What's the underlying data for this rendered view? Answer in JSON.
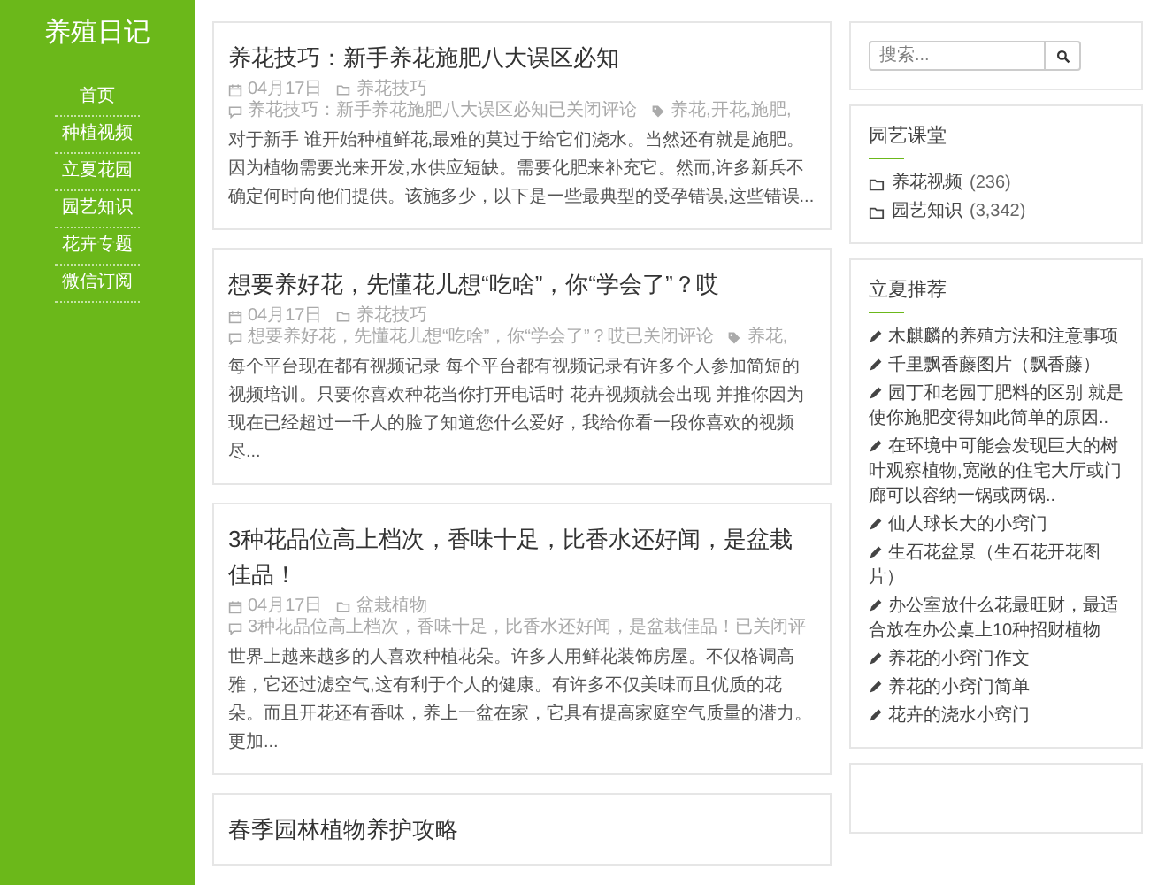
{
  "site_title": "养殖日记",
  "nav": [
    {
      "label": "首页"
    },
    {
      "label": "种植视频"
    },
    {
      "label": "立夏花园"
    },
    {
      "label": "园艺知识"
    },
    {
      "label": "花卉专题"
    },
    {
      "label": "微信订阅"
    }
  ],
  "posts": [
    {
      "title": "养花技巧：新手养花施肥八大误区必知",
      "date": "04月17日",
      "category": "养花技巧",
      "comments": "养花技巧：新手养花施肥八大误区必知已关闭评论",
      "tags": "养花,开花,施肥,",
      "excerpt": "对于新手 谁开始种植鲜花,最难的莫过于给它们浇水。当然还有就是施肥。因为植物需要光来开发,水供应短缺。需要化肥来补充它。然而,许多新兵不确定何时向他们提供。该施多少，以下是一些最典型的受孕错误,这些错误..."
    },
    {
      "title": "想要养好花，先懂花儿想“吃啥”，你“学会了”？哎",
      "date": "04月17日",
      "category": "养花技巧",
      "comments": "想要养好花，先懂花儿想“吃啥”，你“学会了”？哎已关闭评论",
      "tags": "养花,",
      "excerpt": "每个平台现在都有视频记录 每个平台都有视频记录有许多个人参加简短的视频培训。只要你喜欢种花当你打开电话时 花卉视频就会出现 并推你因为现在已经超过一千人的脸了知道您什么爱好，我给你看一段你喜欢的视频尽..."
    },
    {
      "title": "3种花品位高上档次，香味十足，比香水还好闻，是盆栽佳品！",
      "date": "04月17日",
      "category": "盆栽植物",
      "comments": "3种花品位高上档次，香味十足，比香水还好闻，是盆栽佳品！已关闭评",
      "excerpt": "世界上越来越多的人喜欢种植花朵。许多人用鲜花装饰房屋。不仅格调高雅，它还过滤空气,这有利于个人的健康。有许多不仅美味而且优质的花朵。而且开花还有香味，养上一盆在家，它具有提高家庭空气质量的潜力。更加..."
    },
    {
      "title": "春季园林植物养护攻略"
    }
  ],
  "search": {
    "placeholder": "搜索..."
  },
  "widgets": [
    {
      "kind": "categories",
      "title": "园艺课堂",
      "items": [
        {
          "label": "养花视频",
          "count": "(236)"
        },
        {
          "label": "园艺知识",
          "count": "(3,342)"
        }
      ]
    },
    {
      "kind": "links",
      "title": "立夏推荐",
      "items": [
        {
          "label": "木麒麟的养殖方法和注意事项"
        },
        {
          "label": "千里飘香藤图片（飘香藤）"
        },
        {
          "label": "园丁和老园丁肥料的区别 就是使你施肥变得如此简单的原因.."
        },
        {
          "label": "在环境中可能会发现巨大的树叶观察植物,宽敞的住宅大厅或门廊可以容纳一锅或两锅.."
        },
        {
          "label": "仙人球长大的小窍门"
        },
        {
          "label": "生石花盆景（生石花开花图片）"
        },
        {
          "label": "办公室放什么花最旺财，最适合放在办公桌上10种招财植物"
        },
        {
          "label": "养花的小窍门作文"
        },
        {
          "label": "养花的小窍门简单"
        },
        {
          "label": "花卉的浇水小窍门"
        }
      ]
    },
    {
      "kind": "empty"
    }
  ]
}
